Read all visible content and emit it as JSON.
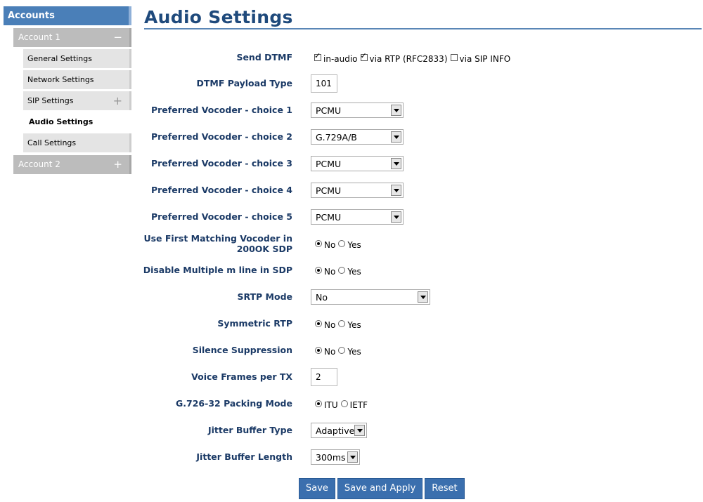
{
  "sidebar": {
    "header": "Accounts",
    "account1": {
      "label": "Account 1",
      "sign": "−"
    },
    "items": [
      {
        "label": "General Settings"
      },
      {
        "label": "Network Settings"
      },
      {
        "label": "SIP Settings",
        "sign": "+"
      },
      {
        "label": "Audio Settings"
      },
      {
        "label": "Call Settings"
      }
    ],
    "account2": {
      "label": "Account 2",
      "sign": "+"
    }
  },
  "page": {
    "title": "Audio Settings"
  },
  "form": {
    "send_dtmf": {
      "label": "Send DTMF",
      "opt1": "in-audio",
      "opt2": "via RTP (RFC2833)",
      "opt3": "via SIP INFO"
    },
    "dtmf_payload": {
      "label": "DTMF Payload Type",
      "value": "101"
    },
    "vocoder1": {
      "label": "Preferred Vocoder - choice 1",
      "value": "PCMU"
    },
    "vocoder2": {
      "label": "Preferred Vocoder - choice 2",
      "value": "G.729A/B"
    },
    "vocoder3": {
      "label": "Preferred Vocoder - choice 3",
      "value": "PCMU"
    },
    "vocoder4": {
      "label": "Preferred Vocoder - choice 4",
      "value": "PCMU"
    },
    "vocoder5": {
      "label": "Preferred Vocoder - choice 5",
      "value": "PCMU"
    },
    "first_match": {
      "label_line1": "Use First Matching Vocoder in",
      "label_line2": "200OK SDP",
      "no": "No",
      "yes": "Yes"
    },
    "disable_m": {
      "label": "Disable Multiple m line in SDP",
      "no": "No",
      "yes": "Yes"
    },
    "srtp": {
      "label": "SRTP Mode",
      "value": "No"
    },
    "symmetric": {
      "label": "Symmetric RTP",
      "no": "No",
      "yes": "Yes"
    },
    "silence": {
      "label": "Silence Suppression",
      "no": "No",
      "yes": "Yes"
    },
    "frames": {
      "label": "Voice Frames per TX",
      "value": "2"
    },
    "g726": {
      "label": "G.726-32 Packing Mode",
      "itu": "ITU",
      "ietf": "IETF"
    },
    "jitter_type": {
      "label": "Jitter Buffer Type",
      "value": "Adaptive"
    },
    "jitter_len": {
      "label": "Jitter Buffer Length",
      "value": "300ms"
    }
  },
  "buttons": {
    "save": "Save",
    "save_apply": "Save and Apply",
    "reset": "Reset"
  }
}
